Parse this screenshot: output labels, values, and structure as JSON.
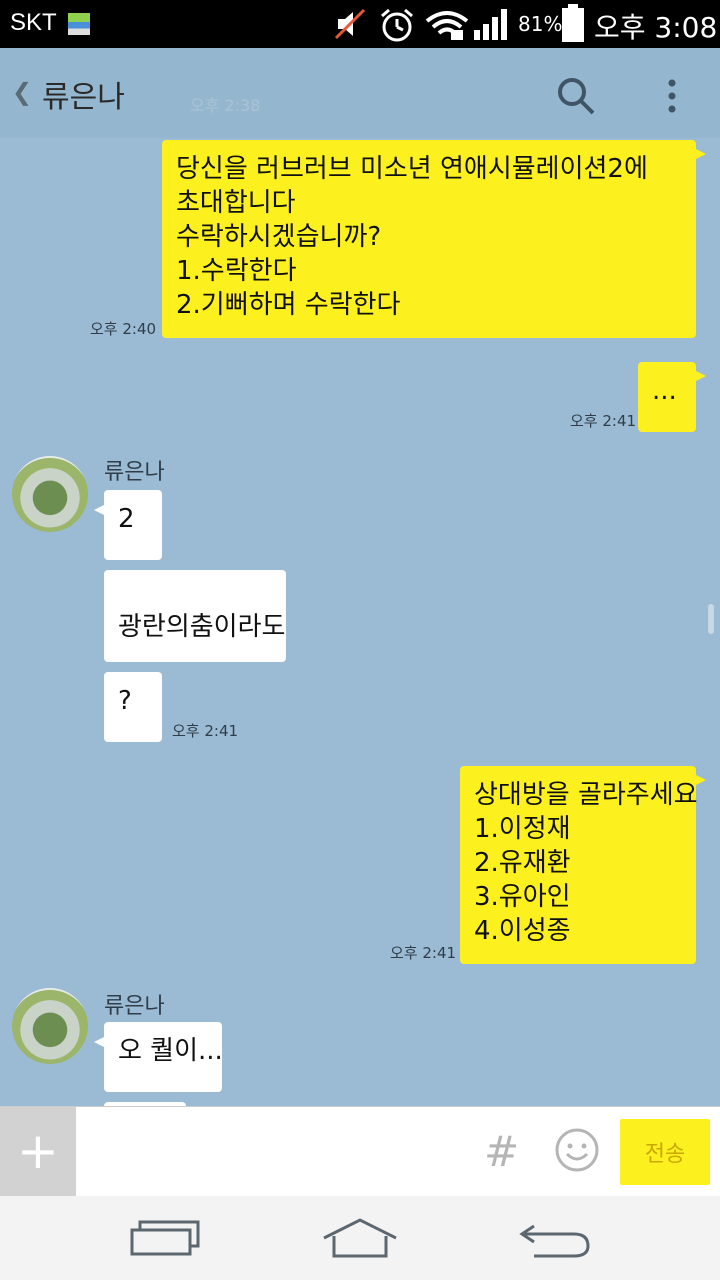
{
  "status_bar": {
    "carrier": "SKT",
    "battery_percent": "81%",
    "time": "오후 3:08"
  },
  "header": {
    "back_symbol": "❮",
    "title": "류은나",
    "faint_overlay": "오후 2:38"
  },
  "messages": {
    "m1": {
      "lines": "당신을 러브러브 미소년 연애시뮬레이션2에\n초대합니다\n수락하시겠습니까?\n1.수락한다\n2.기뻐하며 수락한다",
      "time": "오후 2:40"
    },
    "m2": {
      "text": "...",
      "time": "오후 2:41"
    },
    "sender1": "류은나",
    "m3": {
      "text": "2"
    },
    "m4": {
      "text": "\n광란의춤이라도"
    },
    "m5": {
      "text": "?",
      "time": "오후 2:41"
    },
    "m6": {
      "lines": "상대방을 골라주세요\n1.이정재\n2.유재환\n3.유아인\n4.이성종",
      "time": "오후 2:41"
    },
    "sender2": "류은나",
    "m7": {
      "text": "오 퀄이..."
    }
  },
  "input_bar": {
    "plus": "+",
    "hash": "#",
    "send_label": "전송",
    "placeholder": ""
  },
  "colors": {
    "background": "#9bbbd4",
    "my_bubble": "#fcf01e",
    "their_bubble": "#ffffff"
  },
  "icons": [
    "note-icon",
    "mute-icon",
    "alarm-icon",
    "wifi-icon",
    "signal-icon",
    "battery-icon",
    "search-icon",
    "more-icon",
    "emoji-icon",
    "recent-apps-icon",
    "home-icon",
    "back-nav-icon"
  ]
}
